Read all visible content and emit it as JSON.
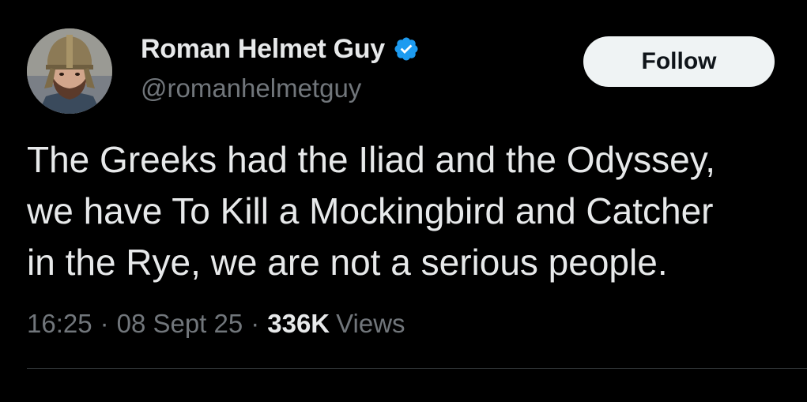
{
  "user": {
    "display_name": "Roman Helmet Guy",
    "handle": "@romanhelmetguy",
    "verified": true,
    "verified_color": "#1d9bf0"
  },
  "follow_button": {
    "label": "Follow"
  },
  "tweet": {
    "text_lines": [
      "The Greeks had the Iliad and the Odyssey,",
      "we have To Kill a Mockingbird and Catcher",
      "in the Rye, we are not a serious people."
    ]
  },
  "meta": {
    "time": "16:25",
    "date": "08 Sept 25",
    "views_count": "336K",
    "views_label": "Views",
    "separator": "·"
  },
  "colors": {
    "background": "#000000",
    "primary_text": "#e7e9ea",
    "secondary_text": "#71767b",
    "button_bg": "#eff3f4",
    "button_text": "#0f1419",
    "divider": "#2f3336"
  },
  "icons": {
    "verified": "verified-badge-icon"
  }
}
